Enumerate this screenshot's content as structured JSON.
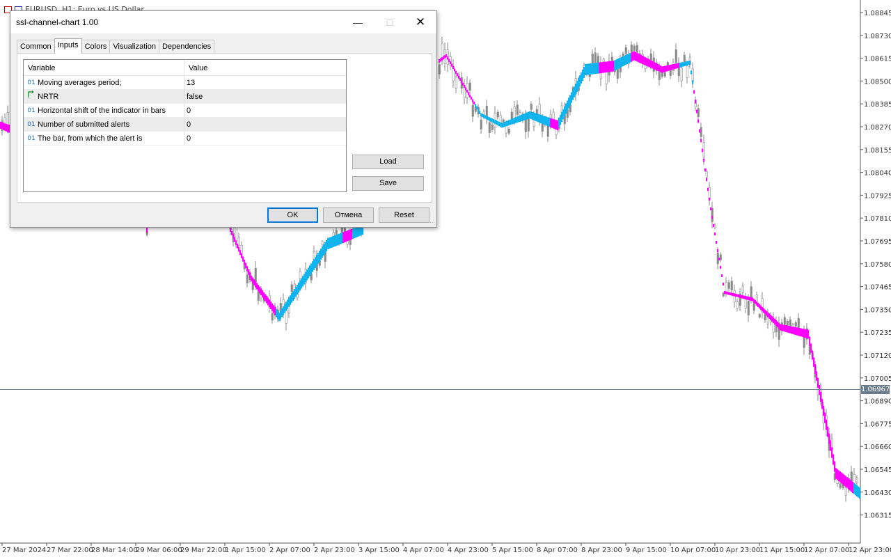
{
  "chart": {
    "title": "EURUSD, H1:  Euro vs US Dollar",
    "current_price": "1.06967",
    "price_labels": [
      "1.08845",
      "1.08730",
      "1.08615",
      "1.08500",
      "1.08385",
      "1.08270",
      "1.08155",
      "1.08040",
      "1.07925",
      "1.07810",
      "1.07695",
      "1.07580",
      "1.07465",
      "1.07350",
      "1.07235",
      "1.07120",
      "1.07005",
      "1.06890",
      "1.06775",
      "1.06660",
      "1.06545",
      "1.06430",
      "1.06315"
    ],
    "time_labels": [
      "27 Mar 2024",
      "27 Mar 22:00",
      "28 Mar 14:00",
      "29 Mar 06:00",
      "29 Mar 22:00",
      "1 Apr 15:00",
      "2 Apr 07:00",
      "2 Apr 23:00",
      "3 Apr 15:00",
      "4 Apr 07:00",
      "4 Apr 23:00",
      "5 Apr 15:00",
      "8 Apr 07:00",
      "8 Apr 23:00",
      "9 Apr 15:00",
      "10 Apr 07:00",
      "10 Apr 23:00",
      "11 Apr 15:00",
      "12 Apr 07:00",
      "12 Apr 23:00"
    ],
    "colors": {
      "channel_up": "#12b4ee",
      "channel_down": "#ff00ff",
      "candle": "#8a8a8a",
      "price_line": "#6b7c8c"
    }
  },
  "dialog": {
    "title": "ssl-channel-chart 1.00",
    "tabs": [
      {
        "label": "Common"
      },
      {
        "label": "Inputs"
      },
      {
        "label": "Colors"
      },
      {
        "label": "Visualization"
      },
      {
        "label": "Dependencies"
      }
    ],
    "active_tab": "Inputs",
    "grid": {
      "header_variable": "Variable",
      "header_value": "Value",
      "rows": [
        {
          "type": "01",
          "variable": "Moving averages period;",
          "value": "13"
        },
        {
          "type": "bool",
          "variable": "NRTR",
          "value": "false"
        },
        {
          "type": "01",
          "variable": "Horizontal shift of the indicator in bars",
          "value": "0"
        },
        {
          "type": "01",
          "variable": "Number of submitted alerts",
          "value": "0"
        },
        {
          "type": "01",
          "variable": "The bar, from which the alert is",
          "value": "0"
        }
      ]
    },
    "buttons": {
      "load": "Load",
      "save": "Save",
      "ok": "OK",
      "cancel": "Отмена",
      "reset": "Reset"
    }
  }
}
